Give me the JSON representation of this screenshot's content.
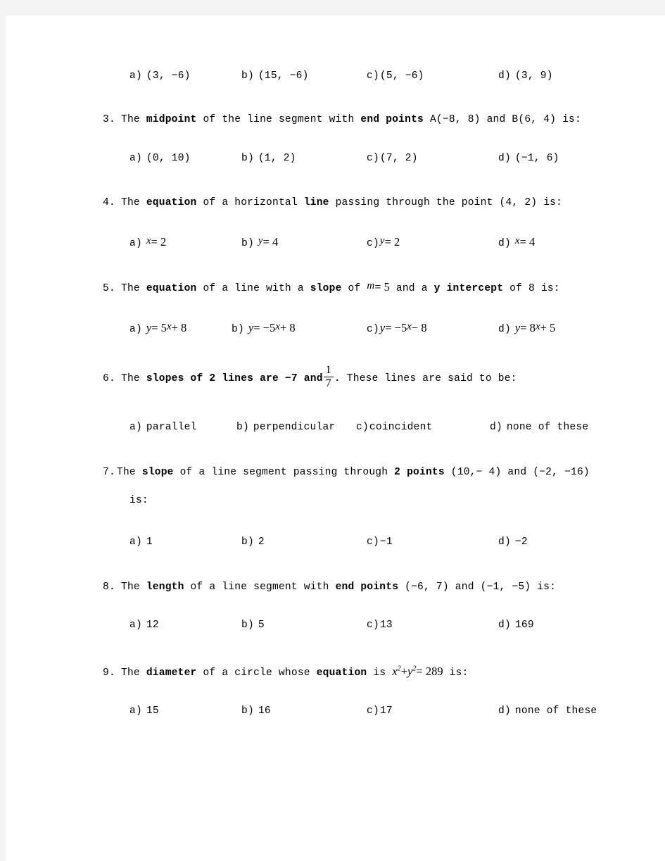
{
  "document": {
    "type": "multiple-choice-worksheet",
    "subject": "Coordinate Geometry / Analytic Geometry",
    "page_background": "#ffffff",
    "canvas_background": "#f4f4f4",
    "text_color": "#000000"
  },
  "q2_options": {
    "a_label": "a)",
    "a_text": "(3,  −6)",
    "b_label": "b)",
    "b_text": "(15,  −6)",
    "c_label": "c)",
    "c_text": "(5,  −6)",
    "d_label": "d)",
    "d_text": "(3,  9)"
  },
  "q3": {
    "number": "3.",
    "text_1": "The ",
    "bold_1": "midpoint",
    "text_2": " of the line segment with ",
    "bold_2": "end points",
    "text_3": " A(−8,  8)  and B(6,  4)  is:",
    "options": {
      "a_label": "a)",
      "a_text": "(0,  10)",
      "b_label": "b)",
      "b_text": "(1,  2)",
      "c_label": "c)",
      "c_text": "(7,  2)",
      "d_label": "d)",
      "d_text": "(−1,  6)"
    }
  },
  "q4": {
    "number": "4.",
    "text_1": "The ",
    "bold_1": "equation",
    "text_2": " of a horizontal  ",
    "bold_2": "line",
    "text_3": " passing through the point  (4,  2)  is:",
    "options": {
      "a_label": "a)",
      "a_var": "x",
      "a_rest": "= 2",
      "b_label": "b)",
      "b_var": "y",
      "b_rest": "= 4",
      "c_label": "c)",
      "c_var": "y",
      "c_rest": "= 2",
      "d_label": "d)",
      "d_var": "x",
      "d_rest": "= 4"
    }
  },
  "q5": {
    "number": "5.",
    "text_1": "The ",
    "bold_1": "equation",
    "text_2": " of a line with a ",
    "bold_2": "slope",
    "text_3": " of ",
    "math_m": "m",
    "math_m_rest": "= 5",
    "text_4": " and a ",
    "bold_3": "y intercept",
    "text_5": " of 8 is:",
    "options": {
      "a_label": "a)",
      "a_lhs": "y",
      "a_mid": "= 5",
      "a_var": "x",
      "a_end": "+ 8",
      "b_label": "b)",
      "b_lhs": "y",
      "b_mid": "= −5",
      "b_var": "x",
      "b_end": "+ 8",
      "c_label": "c)",
      "c_lhs": "y",
      "c_mid": "= −5",
      "c_var": "x",
      "c_end": "− 8",
      "d_label": "d)",
      "d_lhs": "y",
      "d_mid": "= 8",
      "d_var": "x",
      "d_end": "+ 5"
    }
  },
  "q6": {
    "number": "6.",
    "text_1": "The ",
    "bold_1": "slopes of 2 lines are −7 and",
    "frac_numerator": "1",
    "frac_denominator": "7",
    "text_2": ".",
    "text_3": "  These lines are said to be:",
    "options": {
      "a_label": "a)",
      "a_text": "parallel",
      "b_label": "b)",
      "b_text": "perpendicular",
      "c_label": "c)",
      "c_text": "coincident",
      "d_label": "d)",
      "d_text": "none of these"
    }
  },
  "q7": {
    "number": "7.",
    "text_1": "The ",
    "bold_1": "slope",
    "text_2": " of a line segment passing through ",
    "bold_2": "2 points",
    "text_3": " (10,− 4)  and  (−2,  −16)",
    "continuation": "is:",
    "options": {
      "a_label": "a)",
      "a_text": "1",
      "b_label": "b)",
      "b_text": "2",
      "c_label": "c)",
      "c_text": "−1",
      "d_label": "d)",
      "d_text": "−2"
    }
  },
  "q8": {
    "number": "8.",
    "text_1": "The ",
    "bold_1": "length",
    "text_2": " of a line segment with ",
    "bold_2": "end points",
    "text_3": " (−6,  7)  and  (−1,  −5)  is:",
    "options": {
      "a_label": "a)",
      "a_text": "12",
      "b_label": "b)",
      "b_text": "5",
      "c_label": "c)",
      "c_text": "13",
      "d_label": "d)",
      "d_text": "169"
    }
  },
  "q9": {
    "number": "9.",
    "text_1": "The ",
    "bold_1": "diameter",
    "text_2": " of a circle whose ",
    "bold_2": "equation",
    "text_3": " is ",
    "math_x": "x",
    "math_plus": "+",
    "math_y": "y",
    "math_eq": "= 289",
    "text_4": " is:",
    "options": {
      "a_label": "a)",
      "a_text": "15",
      "b_label": "b)",
      "b_text": "16",
      "c_label": "c)",
      "c_text": "17",
      "d_label": "d)",
      "d_text": "none of these"
    }
  }
}
